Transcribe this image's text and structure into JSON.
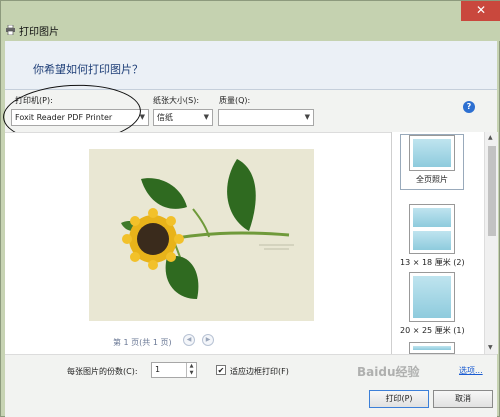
{
  "window": {
    "title": "打印图片",
    "close": "✕"
  },
  "header": {
    "question": "你希望如何打印图片？"
  },
  "toolbar": {
    "printer_label": "打印机(P):",
    "printer_value": "Foxit Reader PDF Printer",
    "paper_label": "纸张大小(S):",
    "paper_value": "信纸",
    "quality_label": "质量(Q):",
    "quality_value": "",
    "help": "?"
  },
  "preview": {
    "pager": "第 1 页(共 1 页)",
    "prev": "◀",
    "next": "▶"
  },
  "layouts": [
    {
      "label": "全页照片"
    },
    {
      "label": "13 × 18 厘米 (2)"
    },
    {
      "label": "20 × 25 厘米 (1)"
    }
  ],
  "footer": {
    "copies_label": "每张图片的份数(C):",
    "copies_value": "1",
    "fit_label": "适应边框打印(F)",
    "fit_checked": "✔",
    "options_link": "选项...",
    "print_button": "打印(P)",
    "cancel_button": "取消"
  },
  "watermark": "Baidu经验"
}
